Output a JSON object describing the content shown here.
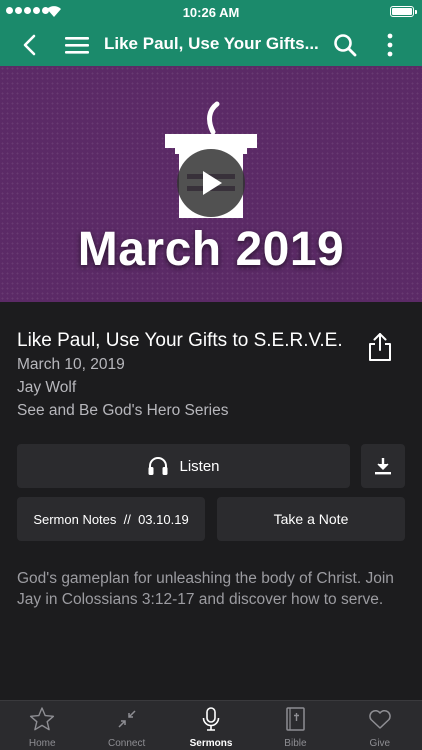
{
  "status_bar": {
    "time": "10:26 AM"
  },
  "nav": {
    "title": "Like Paul, Use Your Gifts..."
  },
  "hero": {
    "text": "March 2019"
  },
  "sermon": {
    "title": "Like Paul, Use Your Gifts to S.E.R.V.E.",
    "date": "March 10, 2019",
    "speaker": "Jay Wolf",
    "series": "See and Be God's Hero Series",
    "description": "God's gameplan for unleashing the body of Christ. Join Jay in Colossians 3:12-17 and discover how to serve."
  },
  "actions": {
    "listen_label": "Listen",
    "notes_label": "Sermon Notes  //  03.10.19",
    "take_note_label": "Take a Note"
  },
  "tabs": [
    {
      "label": "Home",
      "icon": "star-icon"
    },
    {
      "label": "Connect",
      "icon": "connect-icon"
    },
    {
      "label": "Sermons",
      "icon": "microphone-icon",
      "active": true
    },
    {
      "label": "Bible",
      "icon": "bible-icon"
    },
    {
      "label": "Give",
      "icon": "heart-icon"
    }
  ],
  "colors": {
    "brand": "#1b8a6b",
    "hero_bg": "#5b2a66",
    "background": "#1c1c1e"
  }
}
